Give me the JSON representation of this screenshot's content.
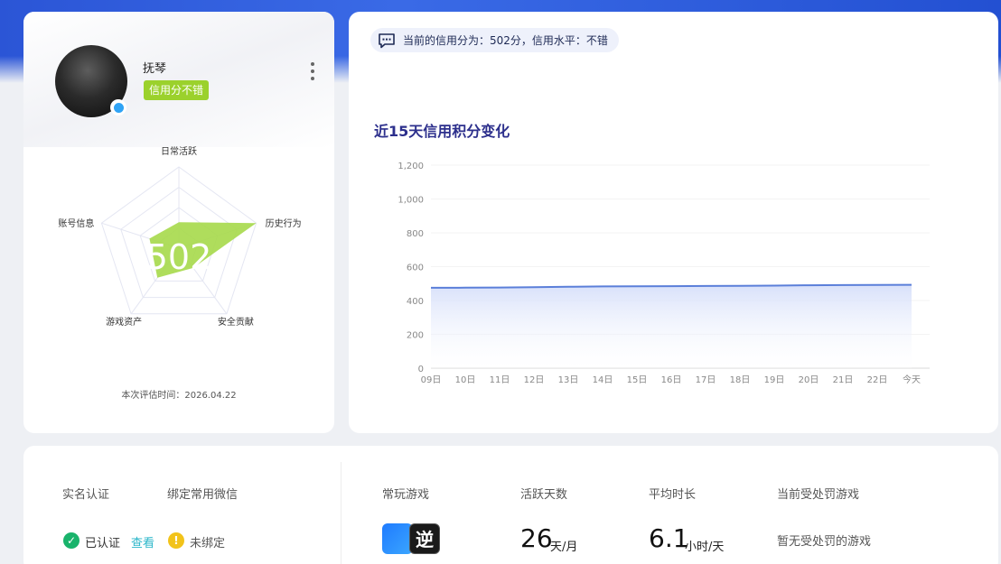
{
  "profile": {
    "username": "抚琴",
    "credit_tag": "信用分不错",
    "radar": {
      "score_text": "502",
      "axes": [
        "日常活跃",
        "历史行为",
        "安全贡献",
        "游戏资产",
        "账号信息"
      ],
      "values": [
        0.32,
        1.0,
        0.3,
        0.45,
        0.38
      ]
    },
    "eval_time": "本次评估时间：2026.04.22"
  },
  "notice": {
    "text": "当前的信用分为：502分，信用水平：不错"
  },
  "chart_data": {
    "type": "area",
    "title": "近15天信用积分变化",
    "categories": [
      "09日",
      "10日",
      "11日",
      "12日",
      "13日",
      "14日",
      "15日",
      "16日",
      "17日",
      "18日",
      "19日",
      "20日",
      "21日",
      "22日",
      "今天"
    ],
    "y_ticks": [
      "0",
      "200",
      "400",
      "600",
      "800",
      "1,000",
      "1,200"
    ],
    "values": [
      475,
      476,
      477,
      479,
      481,
      483,
      484,
      485,
      486,
      487,
      488,
      490,
      491,
      492,
      493
    ],
    "ylim": [
      0,
      1200
    ],
    "line_color": "#5b7fd9",
    "fill_color": "#dbe3fb"
  },
  "stats": {
    "realname_label": "实名认证",
    "realname_value": "已认证",
    "realname_link": "查看",
    "wechat_label": "绑定常用微信",
    "wechat_value": "未绑定",
    "games_label": "常玩游戏",
    "game_icon_glyph": "逆",
    "active_label": "活跃天数",
    "active_value": "26",
    "active_unit": "天/月",
    "avg_label": "平均时长",
    "avg_value": "6.1",
    "avg_unit": "小时/天",
    "penalty_label": "当前受处罚游戏",
    "penalty_value": "暂无受处罚的游戏"
  }
}
